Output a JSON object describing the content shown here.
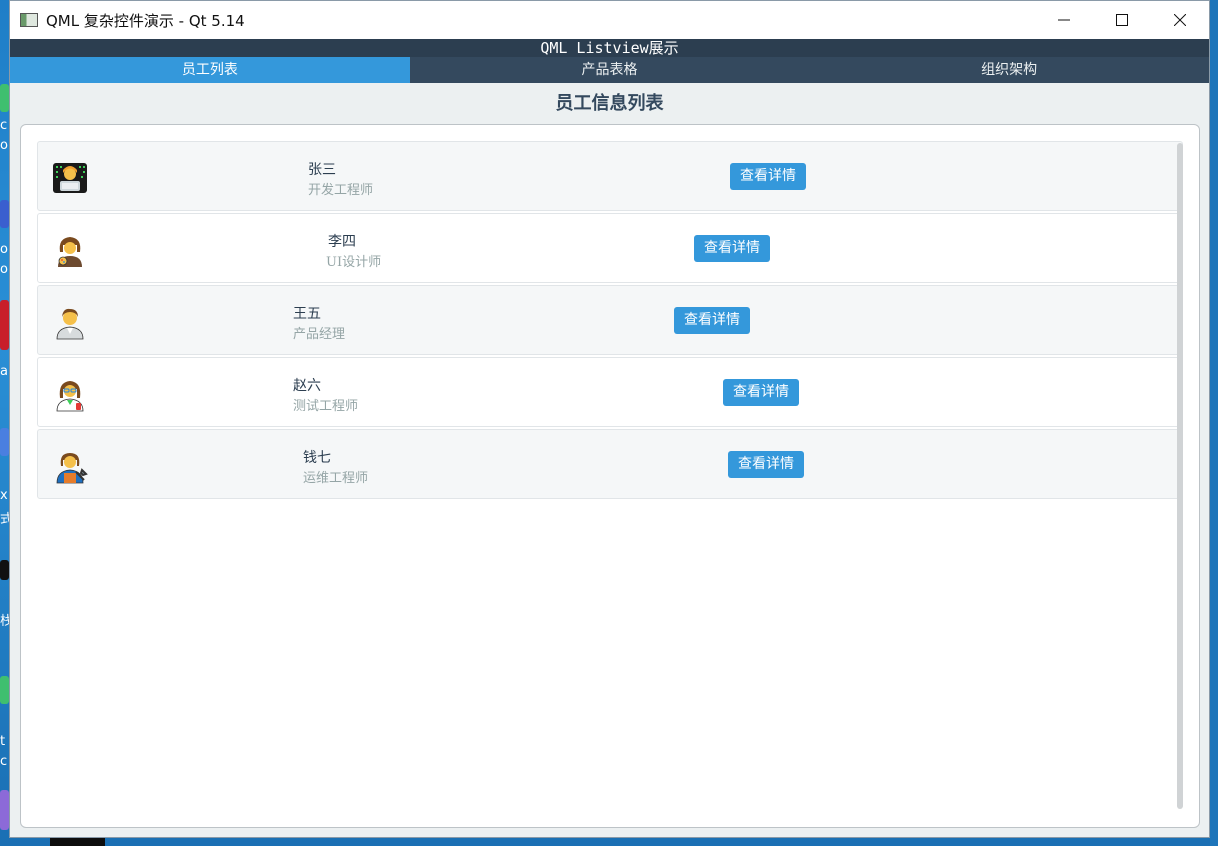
{
  "window": {
    "title": "QML 复杂控件演示 - Qt 5.14",
    "controls": [
      "minimize-icon",
      "maximize-icon",
      "close-icon"
    ]
  },
  "app": {
    "header": "QML Listview展示",
    "tabs": [
      {
        "label": "员工列表",
        "active": true
      },
      {
        "label": "产品表格",
        "active": false
      },
      {
        "label": "组织架构",
        "active": false
      }
    ],
    "page_title": "员工信息列表"
  },
  "employees": [
    {
      "name": "张三",
      "role": "开发工程师",
      "avatar": "developer-emoji-icon",
      "button": "查看详情"
    },
    {
      "name": "李四",
      "role": "UI设计师",
      "avatar": "artist-emoji-icon",
      "button": "查看详情"
    },
    {
      "name": "王五",
      "role": "产品经理",
      "avatar": "office-worker-emoji-icon",
      "button": "查看详情"
    },
    {
      "name": "赵六",
      "role": "测试工程师",
      "avatar": "scientist-emoji-icon",
      "button": "查看详情"
    },
    {
      "name": "钱七",
      "role": "运维工程师",
      "avatar": "mechanic-emoji-icon",
      "button": "查看详情"
    }
  ],
  "desktop_fragments": [
    "c",
    "o",
    "o",
    "o",
    "a",
    "x",
    "式",
    "栈",
    "t",
    "c"
  ],
  "colors": {
    "header": "#2c3e50",
    "tabbar": "#34495e",
    "accent": "#3498db",
    "role_text": "#95a5a6",
    "background": "#ecf0f1"
  }
}
